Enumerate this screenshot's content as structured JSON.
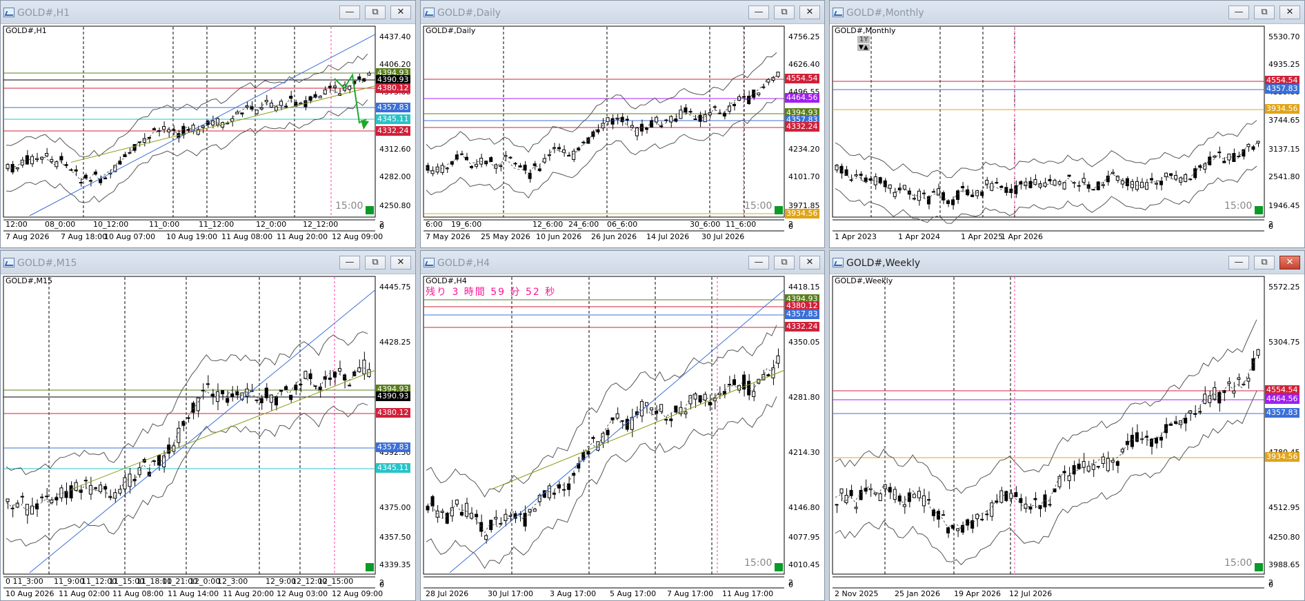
{
  "windows": [
    {
      "id": "h1",
      "title": "GOLD#,H1",
      "symbol": "GOLD#,H1",
      "active": false,
      "countdown": "15:00",
      "price_axis": [
        "4437.40",
        "4406.20",
        "4375.00",
        "4343.80",
        "4312.60",
        "4282.00",
        "4250.80",
        "2",
        "0"
      ],
      "price_labels": [
        {
          "text": "4394.93",
          "color": "#5a7d1b"
        },
        {
          "text": "4390.93",
          "color": "#000000"
        },
        {
          "text": "4380.12",
          "color": "#d0213a"
        },
        {
          "text": "4357.83",
          "color": "#3b6fd8"
        },
        {
          "text": "4345.11",
          "color": "#27c3c8"
        },
        {
          "text": "4332.24",
          "color": "#d0213a"
        }
      ],
      "time_axis": [
        "12:00",
        "08_0:00",
        "10_12:00",
        "11_0:00",
        "11_12:00",
        "12_0:00",
        "12_12:00"
      ],
      "date_axis": [
        "7 Aug 2026",
        "7 Aug 18:00",
        "10 Aug 07:00",
        "10 Aug 19:00",
        "11 Aug 08:00",
        "11 Aug 20:00",
        "12 Aug 09:00"
      ]
    },
    {
      "id": "daily",
      "title": "GOLD#,Daily",
      "symbol": "GOLD#,Daily",
      "active": false,
      "countdown": "15:00",
      "price_axis": [
        "4756.25",
        "4626.40",
        "4496.55",
        "4366.70",
        "4234.20",
        "4101.70",
        "3971.85",
        "2",
        "0"
      ],
      "price_labels": [
        {
          "text": "4554.54",
          "color": "#d0213a"
        },
        {
          "text": "4464.56",
          "color": "#a020f0"
        },
        {
          "text": "4394.93",
          "color": "#5a7d1b"
        },
        {
          "text": "4357.83",
          "color": "#3b6fd8"
        },
        {
          "text": "4332.24",
          "color": "#d0213a"
        },
        {
          "text": "3934.56",
          "color": "#e0a418"
        }
      ],
      "time_axis": [
        "6:00",
        "19_6:00",
        "12_6:00",
        "24_6:00",
        "06_6:00",
        "30_6:00",
        "11_6:00"
      ],
      "date_axis": [
        "7 May 2026",
        "25 May 2026",
        "10 Jun 2026",
        "26 Jun 2026",
        "14 Jul 2026",
        "30 Jul 2026"
      ]
    },
    {
      "id": "monthly",
      "title": "GOLD#,Monthly",
      "symbol": "GOLD#,Monthly",
      "active": false,
      "countdown": "15:00",
      "extra_labels": [
        "1Y",
        "▼▲"
      ],
      "price_axis": [
        "5530.70",
        "4935.25",
        "4339.80",
        "3744.65",
        "3137.15",
        "2541.80",
        "1946.45",
        "2",
        "0"
      ],
      "price_labels": [
        {
          "text": "4554.54",
          "color": "#d0213a"
        },
        {
          "text": "4357.83",
          "color": "#3b6fd8"
        },
        {
          "text": "3934.56",
          "color": "#e0a418"
        }
      ],
      "time_axis": [],
      "date_axis": [
        "1 Apr 2023",
        "1 Apr 2024",
        "1 Apr 2025",
        "1 Apr 2026"
      ]
    },
    {
      "id": "m15",
      "title": "GOLD#,M15",
      "symbol": "GOLD#,M15",
      "active": false,
      "countdown": "",
      "price_axis": [
        "4445.75",
        "4428.25",
        "4410.00",
        "4392.50",
        "4375.00",
        "4357.50",
        "4339.35",
        "2",
        "0"
      ],
      "price_labels": [
        {
          "text": "4394.93",
          "color": "#5a7d1b"
        },
        {
          "text": "4390.93",
          "color": "#000000"
        },
        {
          "text": "4380.12",
          "color": "#d0213a"
        },
        {
          "text": "4357.83",
          "color": "#3b6fd8"
        },
        {
          "text": "4345.11",
          "color": "#27c3c8"
        }
      ],
      "time_axis": [
        "0 11_3:00",
        "11_9:00",
        "11_12:00",
        "11_15:00",
        "11_18:00",
        "11_21:00",
        "12_0:00",
        "12_3:00",
        "12_9:00",
        "12_12:00",
        "12_15:00"
      ],
      "date_axis": [
        "10 Aug 2026",
        "11 Aug 02:00",
        "11 Aug 08:00",
        "11 Aug 14:00",
        "11 Aug 20:00",
        "12 Aug 03:00",
        "12 Aug 09:00"
      ]
    },
    {
      "id": "h4",
      "title": "GOLD#,H4",
      "symbol": "GOLD#,H4",
      "active": false,
      "countdown": "15:00",
      "remaining": "残り 3 時間 59 分 52 秒",
      "price_axis": [
        "4418.15",
        "4350.05",
        "4281.80",
        "4214.30",
        "4146.80",
        "4077.95",
        "4010.45",
        "2",
        "0"
      ],
      "price_labels": [
        {
          "text": "4394.93",
          "color": "#5a7d1b"
        },
        {
          "text": "4380.12",
          "color": "#d0213a"
        },
        {
          "text": "4357.83",
          "color": "#3b6fd8"
        },
        {
          "text": "4332.24",
          "color": "#d0213a"
        }
      ],
      "time_axis": [],
      "date_axis": [
        "28 Jul 2026",
        "30 Jul 17:00",
        "3 Aug 17:00",
        "5 Aug 17:00",
        "7 Aug 17:00",
        "11 Aug 17:00"
      ]
    },
    {
      "id": "weekly",
      "title": "GOLD#,Weekly",
      "symbol": "GOLD#,Weekly",
      "active": true,
      "countdown": "15:00",
      "price_axis": [
        "5572.25",
        "5304.75",
        "5042.60",
        "4780.45",
        "4512.95",
        "4250.80",
        "3988.65",
        "2",
        "0"
      ],
      "price_labels": [
        {
          "text": "4554.54",
          "color": "#d0213a"
        },
        {
          "text": "4464.56",
          "color": "#a020f0"
        },
        {
          "text": "4357.83",
          "color": "#3b6fd8"
        },
        {
          "text": "3934.56",
          "color": "#e0a418"
        }
      ],
      "time_axis": [],
      "date_axis": [
        "2 Nov 2025",
        "25 Jan 2026",
        "19 Apr 2026",
        "12 Jul 2026"
      ]
    }
  ],
  "buttons": {
    "minimize": "—",
    "restore": "⧉",
    "close": "✕"
  },
  "colors": {
    "bull": "#ffffff",
    "bear": "#000000",
    "blue_trend": "#3b6fd8",
    "olive_trend": "#8a9a14",
    "green_arrow": "#1ea82a",
    "pink_vline": "#ff3ea5"
  }
}
